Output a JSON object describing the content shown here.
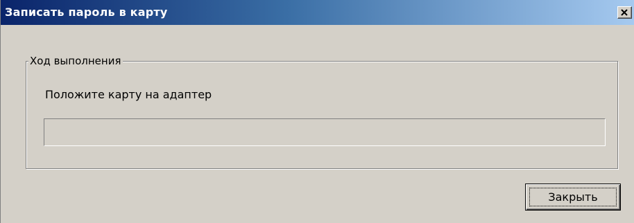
{
  "window": {
    "title": "Записать пароль в карту",
    "close_icon": "close-x-icon"
  },
  "group": {
    "legend": "Ход выполнения",
    "status_text": "Положите карту на адаптер",
    "progress_percent": 0
  },
  "buttons": {
    "close_label": "Закрыть"
  },
  "colors": {
    "titlebar_start": "#0a246a",
    "titlebar_end": "#a6caf0",
    "face": "#d4d0c8"
  }
}
